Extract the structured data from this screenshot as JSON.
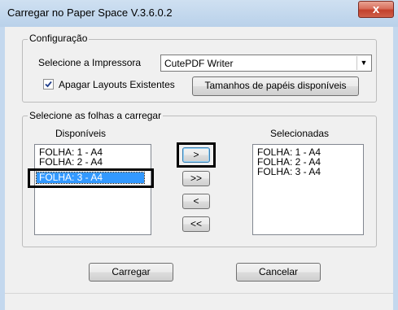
{
  "window": {
    "title": "Carregar no Paper Space V.3.6.0.2",
    "close_label": "x"
  },
  "config": {
    "legend": "Configuração",
    "printer_label": "Selecione a Impressora",
    "printer_value": "CutePDF Writer",
    "checkbox_label": "Apagar Layouts Existentes",
    "checkbox_checked": true,
    "paper_sizes_button": "Tamanhos de papéis disponíveis"
  },
  "sheets": {
    "legend": "Selecione as folhas a carregar",
    "available_header": "Disponíveis",
    "selected_header": "Selecionadas",
    "available": [
      "FOLHA: 1  - A4",
      "FOLHA: 2  - A4",
      "FOLHA: 3  - A4"
    ],
    "available_selected_index": 2,
    "selected": [
      "FOLHA: 1  - A4",
      "FOLHA: 2  - A4",
      "FOLHA: 3  - A4"
    ],
    "move_one_right": ">",
    "move_all_right": ">>",
    "move_one_left": "<",
    "move_all_left": "<<"
  },
  "actions": {
    "load": "Carregar",
    "cancel": "Cancelar"
  },
  "colors": {
    "selection": "#3399ff",
    "title_bar": "#b9d1ea",
    "close_button": "#c2412c"
  }
}
